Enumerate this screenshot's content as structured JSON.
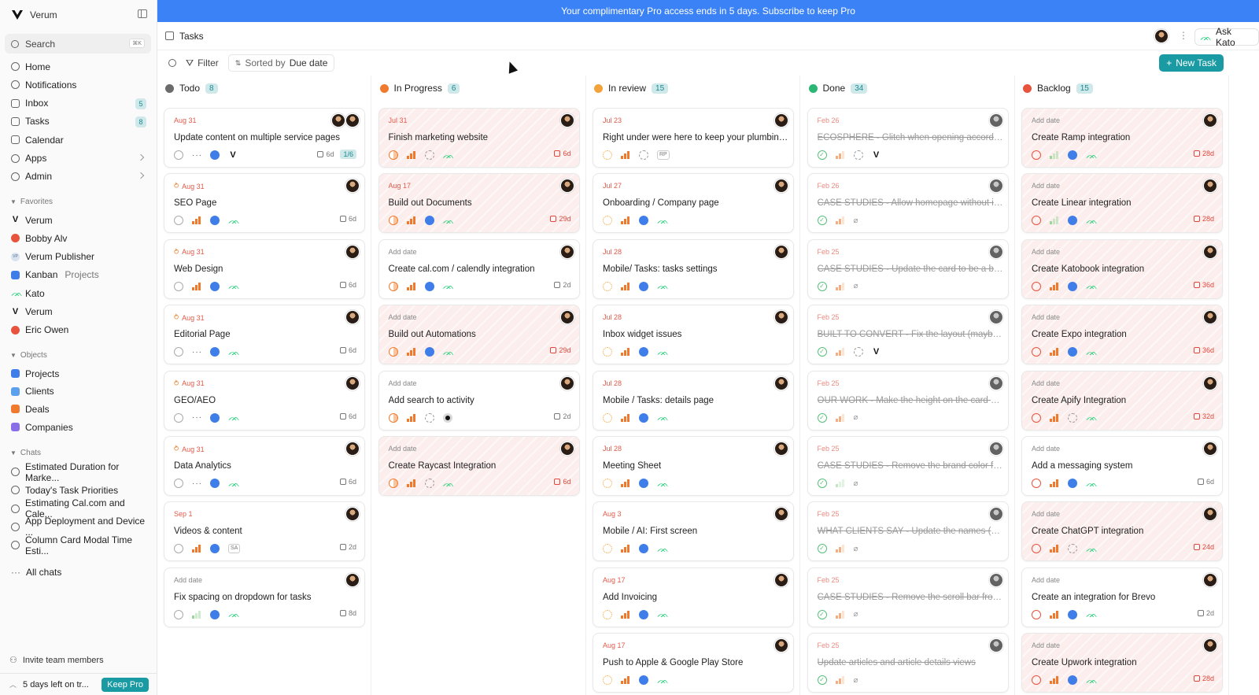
{
  "sidebar": {
    "workspace": "Verum",
    "search": {
      "placeholder": "Search",
      "shortcut": "⌘K"
    },
    "nav": [
      {
        "label": "Home",
        "icon": "home-icon"
      },
      {
        "label": "Notifications",
        "icon": "bell-icon"
      },
      {
        "label": "Inbox",
        "icon": "inbox-icon",
        "badge": "5"
      },
      {
        "label": "Tasks",
        "icon": "tasks-icon",
        "badge": "8"
      },
      {
        "label": "Calendar",
        "icon": "calendar-icon"
      },
      {
        "label": "Apps",
        "icon": "apps-icon"
      },
      {
        "label": "Admin",
        "icon": "admin-icon"
      }
    ],
    "favorites_label": "Favorites",
    "favorites": [
      {
        "label": "Verum",
        "sub": "",
        "icon": "verum-logo-icon"
      },
      {
        "label": "Bobby Alv",
        "sub": "",
        "icon": "user-dot-icon"
      },
      {
        "label": "Verum Publisher",
        "sub": "",
        "icon": "publisher-icon"
      },
      {
        "label": "Kanban",
        "sub": "Projects",
        "icon": "kanban-icon"
      },
      {
        "label": "Kato",
        "sub": "",
        "icon": "kato-icon"
      },
      {
        "label": "Verum",
        "sub": "",
        "icon": "verum-logo-icon"
      },
      {
        "label": "Eric Owen",
        "sub": "",
        "icon": "user-dot-icon"
      }
    ],
    "objects_label": "Objects",
    "objects": [
      {
        "label": "Projects",
        "icon": "projects-icon"
      },
      {
        "label": "Clients",
        "icon": "clients-icon"
      },
      {
        "label": "Deals",
        "icon": "deals-icon"
      },
      {
        "label": "Companies",
        "icon": "companies-icon"
      }
    ],
    "chats_label": "Chats",
    "chats": [
      {
        "label": "Estimated Duration for Marke..."
      },
      {
        "label": "Today's Task Priorities"
      },
      {
        "label": "Estimating Cal.com and Cale..."
      },
      {
        "label": "App Deployment and Device ..."
      },
      {
        "label": "Column Card Modal Time Esti..."
      }
    ],
    "all_chats": "All chats",
    "invite": "Invite team members",
    "trial": "5 days left on tr...",
    "keep_pro": "Keep Pro"
  },
  "banner": "Your complimentary Pro access ends in 5 days. Subscribe to keep Pro",
  "page": {
    "title": "Tasks",
    "ask": "Ask Kato"
  },
  "toolbar": {
    "filter": "Filter",
    "sorted_prefix": "Sorted by",
    "sorted_value": "Due date",
    "new_task": "New Task"
  },
  "columns": [
    {
      "name": "Todo",
      "count": "8",
      "color": "#6b6b6b",
      "type": "todo",
      "cards": [
        {
          "date": "Aug 31",
          "title": "Update content on multiple service pages",
          "est": "6d",
          "subtasks": "1/6",
          "two_avatars": true,
          "pri": "none",
          "proj": "blue",
          "extra": "v",
          "dots": true,
          "overdue": false,
          "loop": false,
          "red": false
        },
        {
          "date": "Aug 31",
          "title": "SEO Page",
          "est": "6d",
          "pri": "high",
          "proj": "blue",
          "extra": "kato",
          "loop": true
        },
        {
          "date": "Aug 31",
          "title": "Web Design",
          "est": "6d",
          "pri": "high",
          "proj": "blue",
          "extra": "kato",
          "loop": true
        },
        {
          "date": "Aug 31",
          "title": "Editorial Page",
          "est": "6d",
          "pri": "none",
          "proj": "blue",
          "extra": "kato",
          "dots": true,
          "loop": true
        },
        {
          "date": "Aug 31",
          "title": "GEO/AEO",
          "est": "6d",
          "pri": "none",
          "proj": "blue",
          "extra": "kato",
          "dots": true,
          "loop": true
        },
        {
          "date": "Aug 31",
          "title": "Data Analytics",
          "est": "6d",
          "pri": "none",
          "proj": "blue",
          "extra": "kato",
          "dots": true,
          "loop": true
        },
        {
          "date": "Sep 1",
          "title": "Videos & content",
          "est": "2d",
          "pri": "high",
          "proj": "blue",
          "extra": "SA"
        },
        {
          "date": "Add date",
          "title": "Fix spacing on dropdown for tasks",
          "est": "8d",
          "pri": "low",
          "proj": "blue",
          "extra": "kato",
          "nodate": true
        }
      ]
    },
    {
      "name": "In Progress",
      "count": "6",
      "color": "#f07b2e",
      "type": "prog",
      "cards": [
        {
          "date": "Jul 31",
          "title": "Finish marketing website",
          "est": "6d",
          "pri": "high",
          "proj": "empty",
          "extra": "kato",
          "overdue": true,
          "red": true
        },
        {
          "date": "Aug 17",
          "title": "Build out Documents",
          "est": "29d",
          "pri": "high",
          "proj": "blue",
          "extra": "kato",
          "overdue": true,
          "red": true
        },
        {
          "date": "Add date",
          "title": "Create cal.com / calendly integration",
          "est": "2d",
          "pri": "high",
          "proj": "blue",
          "extra": "kato",
          "nodate": true
        },
        {
          "date": "Add date",
          "title": "Build out Automations",
          "est": "29d",
          "pri": "high",
          "proj": "blue",
          "extra": "kato",
          "nodate": true,
          "overdue": true,
          "red": true
        },
        {
          "date": "Add date",
          "title": "Add search to activity",
          "est": "2d",
          "pri": "high",
          "proj": "empty",
          "extra": "dark",
          "nodate": true
        },
        {
          "date": "Add date",
          "title": "Create Raycast Integration",
          "est": "6d",
          "pri": "high",
          "proj": "empty",
          "extra": "kato",
          "nodate": true,
          "overdue": true,
          "red": true
        }
      ]
    },
    {
      "name": "In review",
      "count": "15",
      "color": "#f3a33b",
      "type": "rev",
      "cards": [
        {
          "date": "Jul 23",
          "title": "Right under were here to keep your plumbing w...",
          "pri": "high",
          "proj": "empty",
          "extra": "RP"
        },
        {
          "date": "Jul 27",
          "title": "Onboarding / Company page",
          "pri": "high",
          "proj": "blue",
          "extra": "kato"
        },
        {
          "date": "Jul 28",
          "title": "Mobile/ Tasks: tasks settings",
          "pri": "high",
          "proj": "blue",
          "extra": "kato"
        },
        {
          "date": "Jul 28",
          "title": "Inbox widget issues",
          "pri": "high",
          "proj": "blue",
          "extra": "kato"
        },
        {
          "date": "Jul 28",
          "title": "Mobile / Tasks: details page",
          "pri": "high",
          "proj": "blue",
          "extra": "kato"
        },
        {
          "date": "Jul 28",
          "title": "Meeting Sheet",
          "pri": "high",
          "proj": "blue",
          "extra": "kato"
        },
        {
          "date": "Aug 3",
          "title": "Mobile / AI: First screen",
          "pri": "high",
          "proj": "blue",
          "extra": "kato"
        },
        {
          "date": "Aug 17",
          "title": "Add Invoicing",
          "pri": "high",
          "proj": "blue",
          "extra": "kato"
        },
        {
          "date": "Aug 17",
          "title": "Push to Apple & Google Play Store",
          "pri": "high",
          "proj": "blue",
          "extra": "kato"
        }
      ]
    },
    {
      "name": "Done",
      "count": "34",
      "color": "#2bb673",
      "type": "done",
      "cards": [
        {
          "date": "Feb 26",
          "title": "ECOSPHERE - Glitch when opening accordion (...",
          "pri": "mid",
          "proj": "empty",
          "extra": "v"
        },
        {
          "date": "Feb 26",
          "title": "CASE STUDIES - Allow homepage without it be...",
          "pri": "mid",
          "extra": "clip"
        },
        {
          "date": "Feb 25",
          "title": "CASE STUDIES - Update the card to be a bit m...",
          "pri": "mid",
          "extra": "clip"
        },
        {
          "date": "Feb 25",
          "title": "BUILT TO CONVERT - Fix the layout (maybe sc...",
          "pri": "mid",
          "proj": "empty",
          "extra": "v"
        },
        {
          "date": "Feb 25",
          "title": "OUR WORK - Make the height on the card smal...",
          "pri": "mid",
          "extra": "clip"
        },
        {
          "date": "Feb 25",
          "title": "CASE STUDIES - Remove the brand color from ...",
          "pri": "low",
          "extra": "clip"
        },
        {
          "date": "Feb 25",
          "title": "WHAT CLIENTS SAY - Update the names (Link...",
          "pri": "mid",
          "extra": "clip"
        },
        {
          "date": "Feb 25",
          "title": "CASE STUDIES - Remove the scroll bar from th...",
          "pri": "mid",
          "extra": "clip"
        },
        {
          "date": "Feb 25",
          "title": "Update articles and article details views",
          "pri": "mid",
          "extra": "clip"
        }
      ]
    },
    {
      "name": "Backlog",
      "count": "15",
      "color": "#e8533d",
      "type": "back",
      "cards": [
        {
          "date": "Add date",
          "title": "Create Ramp integration",
          "est": "28d",
          "pri": "low",
          "proj": "blue",
          "extra": "kato",
          "nodate": true,
          "overdue": true,
          "red": true
        },
        {
          "date": "Add date",
          "title": "Create Linear integration",
          "est": "28d",
          "pri": "low",
          "proj": "blue",
          "extra": "kato",
          "nodate": true,
          "overdue": true,
          "red": true
        },
        {
          "date": "Add date",
          "title": "Create Katobook integration",
          "est": "36d",
          "pri": "high",
          "proj": "blue",
          "extra": "kato",
          "nodate": true,
          "overdue": true,
          "red": true
        },
        {
          "date": "Add date",
          "title": "Create Expo integration",
          "est": "36d",
          "pri": "high",
          "proj": "blue",
          "extra": "kato",
          "nodate": true,
          "overdue": true,
          "red": true
        },
        {
          "date": "Add date",
          "title": "Create Apify Integration",
          "est": "32d",
          "pri": "high",
          "proj": "empty",
          "extra": "kato",
          "nodate": true,
          "overdue": true,
          "red": true
        },
        {
          "date": "Add date",
          "title": "Add a messaging system",
          "est": "6d",
          "pri": "high",
          "proj": "blue",
          "extra": "kato",
          "nodate": true
        },
        {
          "date": "Add date",
          "title": "Create ChatGPT integration",
          "est": "24d",
          "pri": "high",
          "proj": "empty",
          "extra": "kato",
          "nodate": true,
          "overdue": true,
          "red": true
        },
        {
          "date": "Add date",
          "title": "Create an integration for Brevo",
          "est": "2d",
          "pri": "high",
          "proj": "blue",
          "extra": "kato",
          "nodate": true
        },
        {
          "date": "Add date",
          "title": "Create Upwork integration",
          "est": "28d",
          "pri": "high",
          "proj": "blue",
          "extra": "kato",
          "nodate": true,
          "overdue": true,
          "red": true
        }
      ]
    }
  ]
}
